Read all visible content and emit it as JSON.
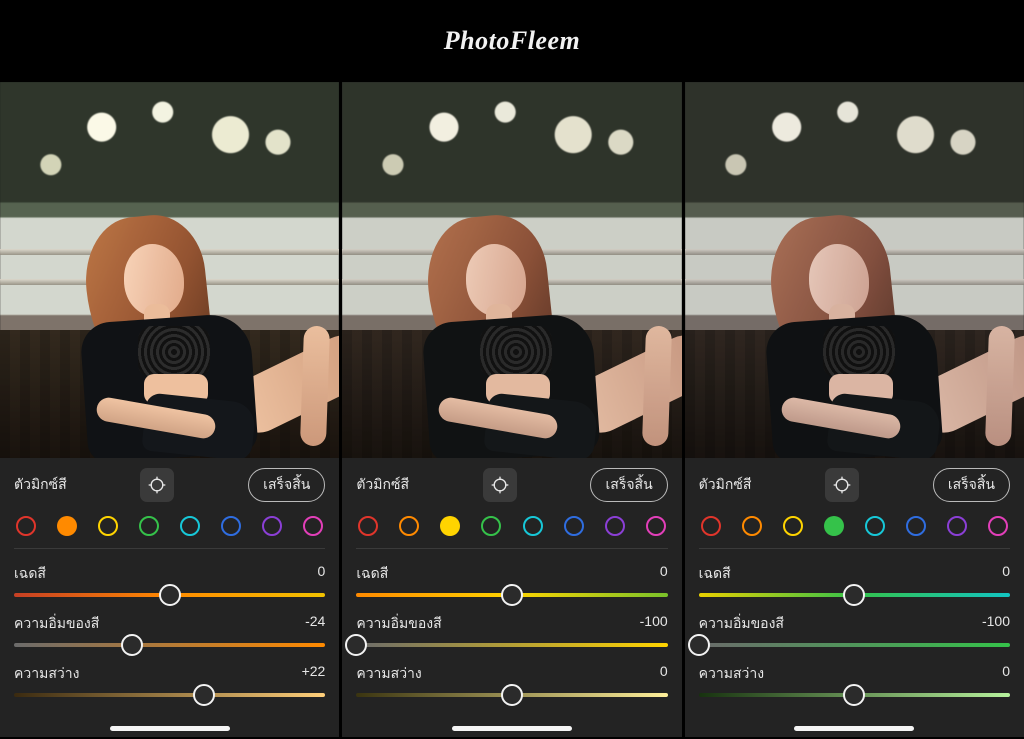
{
  "brand": "PhotoFleem",
  "swatch_colors": [
    "#e0352b",
    "#ff8a00",
    "#ffd400",
    "#35c24a",
    "#17c8d8",
    "#2f6de0",
    "#8b3fd6",
    "#e23fb9"
  ],
  "panels": [
    {
      "tone_class": "tone-a",
      "title": "ตัวมิกซ์สี",
      "done": "เสร็จสิ้น",
      "selected_swatch": 1,
      "sliders": [
        {
          "label": "เฉดสี",
          "value": "0",
          "pos": 50,
          "track": "linear-gradient(to right,#c63f24,#ff8a00,#f2c200)"
        },
        {
          "label": "ความอิ่มของสี",
          "value": "-24",
          "pos": 38,
          "track": "linear-gradient(to right,#6b6b6b,#ff8a00)"
        },
        {
          "label": "ความสว่าง",
          "value": "+22",
          "pos": 61,
          "track": "linear-gradient(to right,#3a2a10,#ffcf7a)"
        }
      ]
    },
    {
      "tone_class": "tone-b",
      "title": "ตัวมิกซ์สี",
      "done": "เสร็จสิ้น",
      "selected_swatch": 2,
      "sliders": [
        {
          "label": "เฉดสี",
          "value": "0",
          "pos": 50,
          "track": "linear-gradient(to right,#ff8a00,#ffd400,#7ac22a)"
        },
        {
          "label": "ความอิ่มของสี",
          "value": "-100",
          "pos": 0,
          "track": "linear-gradient(to right,#6b6b6b,#ffd400)"
        },
        {
          "label": "ความสว่าง",
          "value": "0",
          "pos": 50,
          "track": "linear-gradient(to right,#3a3410,#fff09a)"
        }
      ]
    },
    {
      "tone_class": "tone-c",
      "title": "ตัวมิกซ์สี",
      "done": "เสร็จสิ้น",
      "selected_swatch": 3,
      "sliders": [
        {
          "label": "เฉดสี",
          "value": "0",
          "pos": 50,
          "track": "linear-gradient(to right,#e9d000,#35c24a,#12c5c2)"
        },
        {
          "label": "ความอิ่มของสี",
          "value": "-100",
          "pos": 0,
          "track": "linear-gradient(to right,#6b6b6b,#35c24a)"
        },
        {
          "label": "ความสว่าง",
          "value": "0",
          "pos": 50,
          "track": "linear-gradient(to right,#17320f,#b7f29d)"
        }
      ]
    }
  ]
}
